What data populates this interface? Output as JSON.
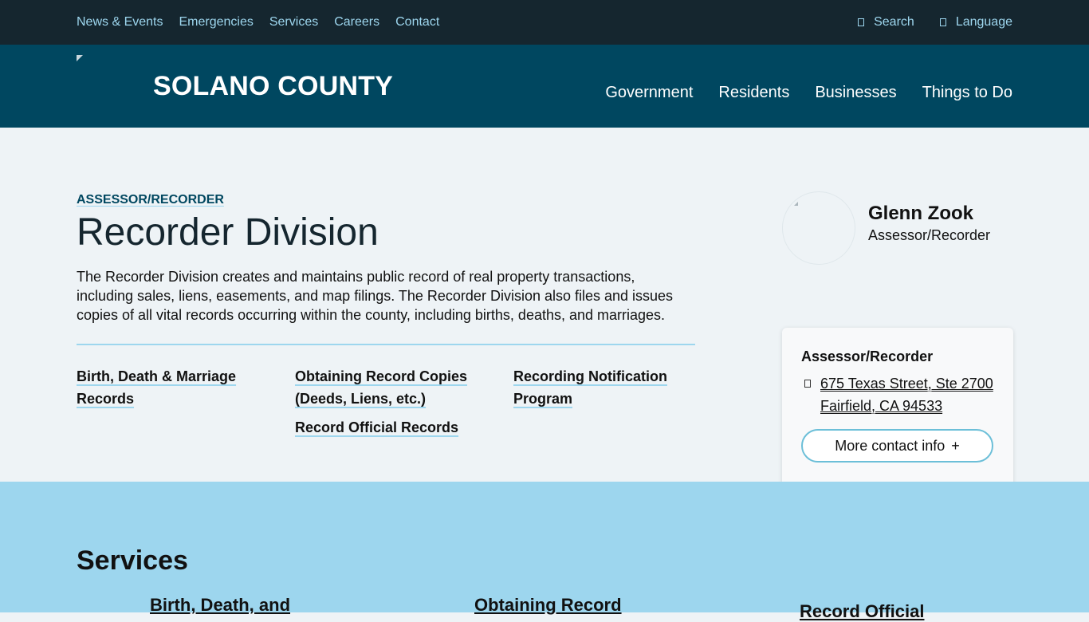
{
  "utility_nav": {
    "links": [
      "News & Events",
      "Emergencies",
      "Services",
      "Careers",
      "Contact"
    ],
    "search_label": "Search",
    "language_label": "Language"
  },
  "header": {
    "site_title": "SOLANO COUNTY",
    "nav": [
      "Government",
      "Residents",
      "Businesses",
      "Things to Do"
    ]
  },
  "page": {
    "eyebrow": "ASSESSOR/RECORDER",
    "title": "Recorder Division",
    "intro": "The Recorder Division creates and maintains public record of real property transactions, including sales, liens, easements, and map filings. The Recorder Division also files and issues copies of all vital records occurring within the county, including births, deaths, and marriages."
  },
  "quick_links": {
    "col1": [
      "Birth, Death & Marriage Records"
    ],
    "col2": [
      "Obtaining Record Copies (Deeds, Liens, etc.)",
      "Record Official Records"
    ],
    "col3": [
      "Recording Notification Program"
    ]
  },
  "official": {
    "name": "Glenn Zook",
    "role": "Assessor/Recorder"
  },
  "contact": {
    "heading": "Assessor/Recorder",
    "address_line1": "675 Texas Street, Ste 2700",
    "address_line2": "Fairfield, CA 94533",
    "more_button": "More contact info",
    "plus": "+"
  },
  "services": {
    "title": "Services",
    "cards": [
      "Birth, Death, and",
      "Obtaining Record",
      "Record Official"
    ]
  },
  "colors": {
    "utility_bg": "#15262f",
    "header_bg": "#004760",
    "accent": "#9dd6ee",
    "page_bg": "#eef3f6"
  }
}
